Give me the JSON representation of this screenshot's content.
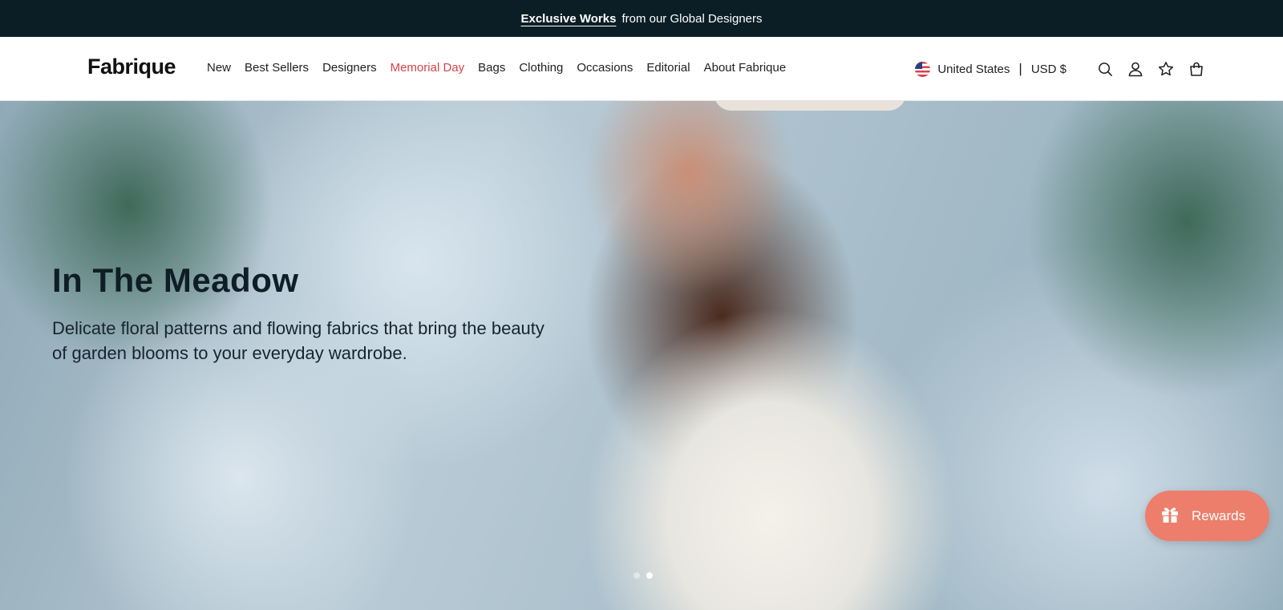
{
  "announcement": {
    "strong": "Exclusive Works",
    "rest": "from our Global Designers"
  },
  "header": {
    "logo": "Fabrique",
    "nav": [
      {
        "label": "New"
      },
      {
        "label": "Best Sellers"
      },
      {
        "label": "Designers"
      },
      {
        "label": "Memorial Day",
        "highlight": true
      },
      {
        "label": "Bags"
      },
      {
        "label": "Clothing"
      },
      {
        "label": "Occasions"
      },
      {
        "label": "Editorial"
      },
      {
        "label": "About Fabrique"
      }
    ],
    "country": "United States",
    "separator": "|",
    "currency": "USD $",
    "icons": [
      "search-icon",
      "account-icon",
      "wishlist-star-icon",
      "cart-bag-icon"
    ]
  },
  "hero": {
    "title": "In The Meadow",
    "subtitle": "Delicate floral patterns and flowing fabrics that bring the beauty of garden blooms to your everyday wardrobe.",
    "slides": {
      "count": 2,
      "active_index": 1
    }
  },
  "rewards": {
    "label": "Rewards"
  },
  "colors": {
    "announcement_bg": "#0b1e26",
    "nav_highlight": "#d6424a",
    "rewards_bg": "#ec7e6b"
  }
}
